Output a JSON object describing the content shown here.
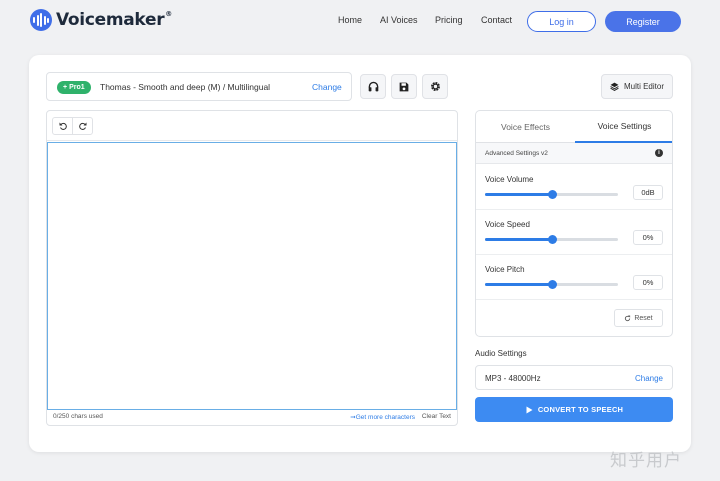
{
  "brand": {
    "name": "Voicemaker",
    "reg": "®",
    "accent": "#3f6ee8"
  },
  "nav": {
    "links": [
      "Home",
      "AI Voices",
      "Pricing",
      "Contact"
    ],
    "login": "Log in",
    "register": "Register"
  },
  "voice": {
    "badge": "Pro1",
    "name": "Thomas - Smooth and deep (M) / Multilingual",
    "change": "Change"
  },
  "toolbar": {
    "headphones_icon": "headphones-icon",
    "save_icon": "save-icon",
    "settings_icon": "gear-icon",
    "multi_editor": "Multi Editor"
  },
  "editor": {
    "undo_icon": "undo-icon",
    "redo_icon": "redo-icon",
    "text": "",
    "chars_used": "0/250 chars used",
    "get_more": "Get more characters",
    "clear": "Clear Text"
  },
  "settings": {
    "tabs": [
      "Voice Effects",
      "Voice Settings"
    ],
    "active_tab": "Voice Settings",
    "advanced": "Advanced Settings v2",
    "sliders": [
      {
        "label": "Voice Volume",
        "value": "0dB",
        "level": 0.5
      },
      {
        "label": "Voice Speed",
        "value": "0%",
        "level": 0.5
      },
      {
        "label": "Voice Pitch",
        "value": "0%",
        "level": 0.5
      }
    ],
    "reset": "Reset"
  },
  "audio": {
    "title": "Audio Settings",
    "format": "MP3 - 48000Hz",
    "change": "Change"
  },
  "convert": "CONVERT TO SPEECH",
  "watermark": "知乎用户",
  "colors": {
    "primary": "#2d7ce6",
    "pro_green": "#2fb26b",
    "convert": "#3d8bf2"
  }
}
